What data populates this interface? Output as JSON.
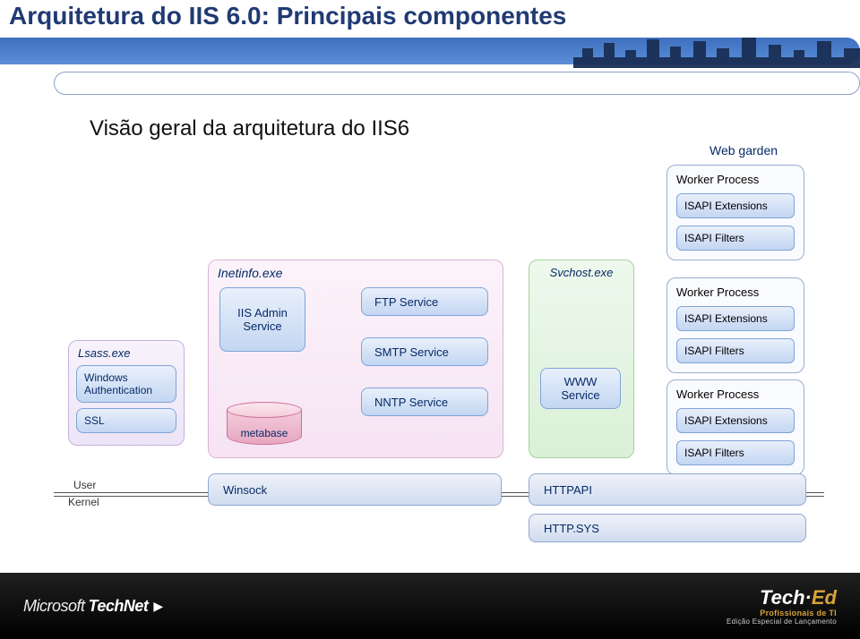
{
  "title": "Arquitetura do IIS 6.0: Principais componentes",
  "subtitle": "Visão geral da arquitetura do IIS6",
  "webgarden_label": "Web garden",
  "lsass": {
    "name": "Lsass.exe",
    "winauth": "Windows Authentication",
    "ssl": "SSL"
  },
  "inetinfo": {
    "name": "Inetinfo.exe",
    "iisadmin": "IIS Admin Service",
    "ftp": "FTP Service",
    "smtp": "SMTP Service",
    "nntp": "NNTP Service",
    "metabase": "metabase"
  },
  "svchost": {
    "name": "Svchost.exe",
    "www": "WWW Service"
  },
  "worker": {
    "title": "Worker Process",
    "ext": "ISAPI Extensions",
    "flt": "ISAPI Filters"
  },
  "boundary": {
    "user": "User",
    "kernel": "Kernel"
  },
  "transport": {
    "winsock": "Winsock",
    "httpapi": "HTTPAPI",
    "httpsys": "HTTP.SYS"
  },
  "footer": {
    "ms": "Microsoft",
    "tn": "TechNet",
    "te_tech": "Tech·",
    "te_ed": "Ed",
    "te_line2": "Profissionais de TI",
    "te_line3": "Edição Especial de Lançamento"
  }
}
